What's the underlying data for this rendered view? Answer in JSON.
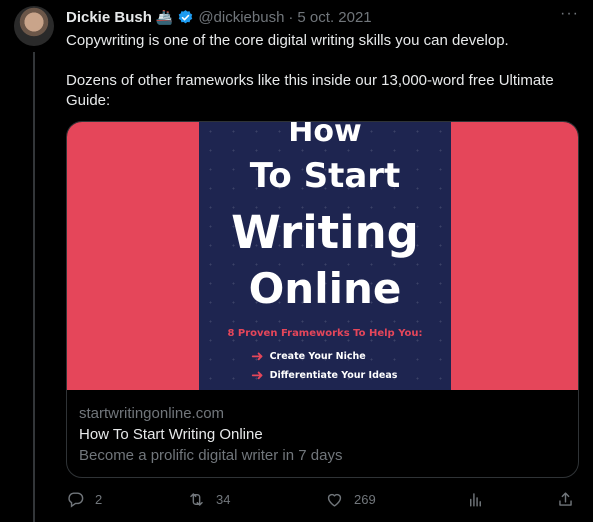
{
  "tweet": {
    "author_name": "Dickie Bush",
    "author_emoji": "🚢",
    "handle": "@dickiebush",
    "separator": "·",
    "date": "5 oct. 2021",
    "more_label": "···",
    "paragraph1": "Copywriting is one of the core digital writing skills you can develop.",
    "paragraph2": "Dozens of other frameworks like this inside our 13,000-word free Ultimate Guide:"
  },
  "card": {
    "image": {
      "title_lines": [
        "How",
        "To Start",
        "Writing",
        "Online"
      ],
      "subtitle": "8 Proven Frameworks To Help You:",
      "items": [
        "Create Your Niche",
        "Differentiate Your Ideas"
      ],
      "colors": {
        "background": "#e5465a",
        "book": "#1e2550"
      }
    },
    "domain": "startwritingonline.com",
    "title": "How To Start Writing Online",
    "description": "Become a prolific digital writer in 7 days"
  },
  "actions": {
    "replies": "2",
    "retweets": "34",
    "likes": "269",
    "icons": [
      "reply-icon",
      "retweet-icon",
      "like-icon",
      "views-icon",
      "share-icon"
    ]
  },
  "colors": {
    "verified": "#1d9bf0",
    "muted": "#71767b",
    "text": "#e7e9ea"
  }
}
